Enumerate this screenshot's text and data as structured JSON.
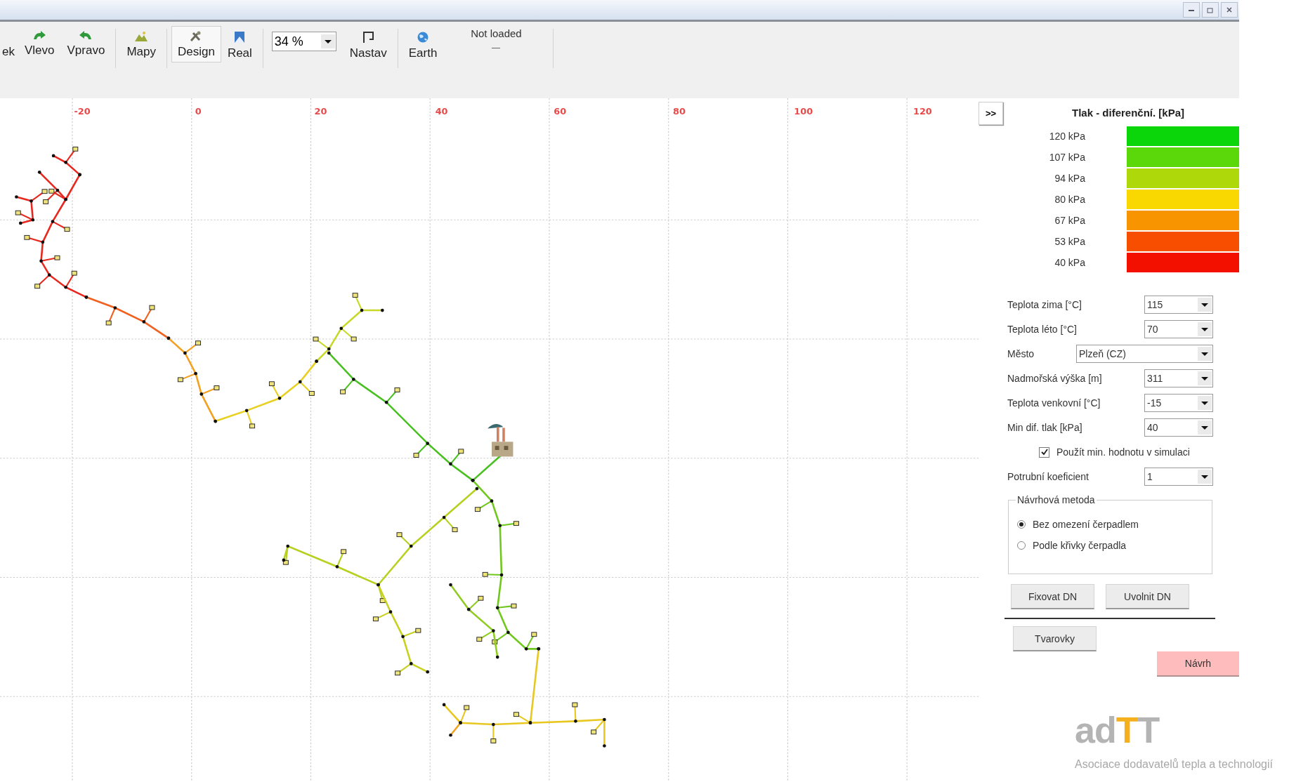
{
  "toolbar": {
    "items": [
      {
        "kind": "button",
        "label": "ek",
        "selected": false
      },
      {
        "kind": "button",
        "label": "Vlevo",
        "selected": false
      },
      {
        "kind": "button",
        "label": "Vpravo",
        "selected": false
      },
      {
        "kind": "separator"
      },
      {
        "kind": "button",
        "label": "Mapy",
        "selected": false
      },
      {
        "kind": "separator"
      },
      {
        "kind": "button",
        "label": "Design",
        "selected": true
      },
      {
        "kind": "button",
        "label": "Real",
        "selected": false
      },
      {
        "kind": "separator"
      },
      {
        "kind": "combo",
        "value": "34 %"
      },
      {
        "kind": "button",
        "label": "Nastav",
        "selected": false
      },
      {
        "kind": "separator"
      },
      {
        "kind": "button",
        "label": "Earth",
        "selected": false
      },
      {
        "kind": "status",
        "label": "Not loaded"
      },
      {
        "kind": "separator"
      }
    ]
  },
  "canvas": {
    "axis_labels": [
      "-20",
      "0",
      "20",
      "40",
      "60",
      "80",
      "100",
      "120"
    ]
  },
  "panel": {
    "expand_button": ">>",
    "legend": {
      "title": "Tlak - diferenční. [kPa]",
      "items": [
        {
          "label": "120 kPa",
          "color": "#0ad60a"
        },
        {
          "label": "107 kPa",
          "color": "#5ad80a"
        },
        {
          "label": "94 kPa",
          "color": "#aed80a"
        },
        {
          "label": "80 kPa",
          "color": "#f8d800"
        },
        {
          "label": "67 kPa",
          "color": "#f89400"
        },
        {
          "label": "53 kPa",
          "color": "#f84e00"
        },
        {
          "label": "40 kPa",
          "color": "#f41000"
        }
      ]
    },
    "fields": [
      {
        "kind": "combo",
        "label": "Teplota zima [°C]",
        "value": "115"
      },
      {
        "kind": "combo",
        "label": "Teplota léto [°C]",
        "value": "70"
      },
      {
        "kind": "wide_combo",
        "label": "Město",
        "value": "Plzeň (CZ)"
      },
      {
        "kind": "combo",
        "label": "Nadmořská výška [m]",
        "value": "311"
      },
      {
        "kind": "combo",
        "label": "Teplota venkovní [°C]",
        "value": "-15"
      },
      {
        "kind": "combo",
        "label": "Min dif. tlak [kPa]",
        "value": "40"
      },
      {
        "kind": "checkbox",
        "label": "Použít min. hodnotu v simulaci",
        "checked": true
      },
      {
        "kind": "combo",
        "label": "Potrubní koeficient",
        "value": "1"
      }
    ],
    "method": {
      "title": "Návrhová metoda",
      "options": [
        {
          "label": "Bez omezení čerpadlem",
          "selected": true
        },
        {
          "label": "Podle křivky čerpadla",
          "selected": false
        }
      ]
    },
    "dn_buttons": [
      "Fixovat DN",
      "Uvolnit DN"
    ],
    "fittings_button": "Tvarovky",
    "design_button": "Návrh"
  },
  "logo": {
    "mark_parts": [
      {
        "text": "ad",
        "color": "#b4b4b4"
      },
      {
        "text": "T",
        "color": "#f5b01e"
      },
      {
        "text": "T",
        "color": "#b4b4b4"
      }
    ],
    "tagline": "Asociace dodavatelů tepla a technologií"
  }
}
